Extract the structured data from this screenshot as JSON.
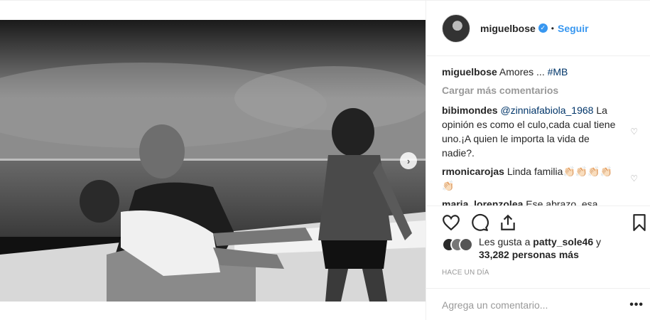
{
  "post": {
    "username": "miguelbose",
    "follow_label": "Seguir",
    "separator": "•",
    "caption": {
      "user": "miguelbose",
      "text": "Amores ...",
      "hashtag": "#MB"
    },
    "load_more": "Cargar más comentarios",
    "comments": [
      {
        "user": "bibimondes",
        "mention": "@zinniafabiola_1968",
        "text": "La opinión es como el culo,cada cual tiene uno.¡A quien le importa la vida de nadie?."
      },
      {
        "user": "rmonicarojas",
        "text": "Linda familia",
        "emoji": "👏🏻👏🏻👏🏻👏🏻👏🏻"
      },
      {
        "user": "maria_lorenzolea",
        "text": "Ese abrazo, esa mirada... sabíamos que eres un padre amantisimo, esta foto es preciosa!! ❤"
      }
    ],
    "likes": {
      "prefix": "Les gusta a",
      "user": "patty_sole46",
      "conj": "y",
      "count_text": "33,282 personas más"
    },
    "time": "HACE UN DÍA",
    "comment_placeholder": "Agrega un comentario...",
    "more_label": "•••",
    "next_label": "›"
  },
  "colors": {
    "accent": "#3897f0",
    "muted": "#999999",
    "text": "#262626"
  },
  "icons": [
    "verified-badge-icon",
    "heart-icon",
    "comment-icon",
    "share-icon",
    "bookmark-icon",
    "carousel-next-icon",
    "more-options-icon"
  ]
}
